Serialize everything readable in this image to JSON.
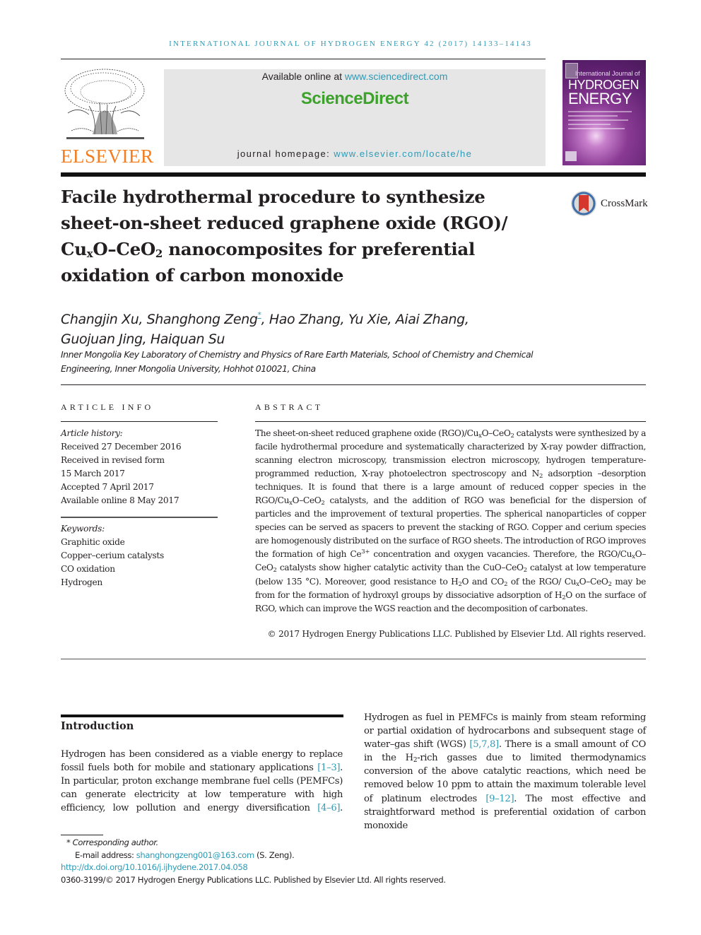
{
  "running_header": "INTERNATIONAL JOURNAL OF HYDROGEN ENERGY 42 (2017) 14133–14143",
  "publisher": {
    "logo_text": "ELSEVIER",
    "brand_color": "#f47d20"
  },
  "sciencedirect": {
    "available_prefix": "Available online at ",
    "available_link": "www.sciencedirect.com",
    "brand": "ScienceDirect",
    "brand_color": "#3da22b",
    "homepage_prefix": "journal homepage: ",
    "homepage_link": "www.elsevier.com/locate/he"
  },
  "cover": {
    "line1": "International Journal of",
    "line2": "HYDROGEN",
    "line3": "ENERGY"
  },
  "crossmark": {
    "label": "CrossMark"
  },
  "article": {
    "title_line1": "Facile hydrothermal procedure to synthesize",
    "title_line2": "sheet-on-sheet reduced graphene oxide (RGO)/",
    "title_line3_parts": [
      "Cu",
      "x",
      "O–CeO",
      "2",
      " nanocomposites for preferential"
    ],
    "title_line4": "oxidation of carbon monoxide",
    "authors_line1_a": "Changjin Xu, Shanghong Zeng",
    "authors_star": "*",
    "authors_line1_b": ", Hao Zhang, Yu Xie, Aiai Zhang,",
    "authors_line2": "Guojuan Jing, Haiquan Su",
    "affiliation_line1": "Inner Mongolia Key Laboratory of Chemistry and Physics of Rare Earth Materials, School of Chemistry and Chemical",
    "affiliation_line2": "Engineering, Inner Mongolia University, Hohhot 010021, China"
  },
  "article_info": {
    "label": "ARTICLE INFO",
    "history_heading": "Article history:",
    "history": [
      "Received 27 December 2016",
      "Received in revised form",
      "15 March 2017",
      "Accepted 7 April 2017",
      "Available online 8 May 2017"
    ],
    "keywords_heading": "Keywords:",
    "keywords": [
      "Graphitic oxide",
      "Copper–cerium catalysts",
      "CO oxidation",
      "Hydrogen"
    ]
  },
  "abstract": {
    "label": "ABSTRACT",
    "s1a": "The sheet-on-sheet reduced graphene oxide (RGO)/Cu",
    "s1b": "O–CeO",
    "s1c": " catalysts were synthesized by a facile hydrothermal procedure and systematically characterized by X-ray powder diffraction, scanning electron microscopy, transmission electron microscopy, hydrogen temperature-programmed reduction, X-ray photoelectron spectroscopy and N",
    "s1d": " adsorption –desorption techniques. It is found that there is a large amount of reduced copper species in the RGO/Cu",
    "s1e": "O–CeO",
    "s1f": " catalysts, and the addition of RGO was beneficial for the dispersion of particles and the improvement of textural properties. The spherical nanoparticles of copper species can be served as spacers to prevent the stacking of RGO. Copper and cerium species are homogenously distributed on the surface of RGO sheets. The introduction of RGO improves the formation of high Ce",
    "s1g": " concentration and oxygen vacancies. Therefore, the RGO/Cu",
    "s1h": "O–CeO",
    "s1i": " catalysts show higher catalytic activity than the CuO–CeO",
    "s1j": " catalyst at low temperature (below 135 °C). Moreover, good resistance to H",
    "s1k": "O and CO",
    "s1l": " of the RGO/ Cu",
    "s1m": "O–CeO",
    "s1n": " may be from for the formation of hydroxyl groups by dissociative adsorption of H",
    "s1o": "O on the surface of RGO, which can improve the WGS reaction and the decomposition of carbonates.",
    "sub_x": "x",
    "sub_2": "2",
    "sup_3plus": "3+",
    "copyright": "© 2017 Hydrogen Energy Publications LLC. Published by Elsevier Ltd. All rights reserved."
  },
  "introduction": {
    "heading": "Introduction",
    "p1a": "Hydrogen has been considered as a viable energy to replace fossil fuels both for mobile and stationary applications ",
    "ref1": "[1–3]",
    "p1b": ". In particular, proton exchange membrane fuel cells (PEMFCs) can generate electricity at low temperature with high efficiency, low pollution and energy diversification ",
    "ref2": "[4–6]",
    "p1c": ".",
    "p2a": "Hydrogen as fuel in PEMFCs is mainly from steam reforming or partial oxidation of hydrocarbons and subsequent stage of water–gas shift (WGS) ",
    "ref3": "[5,7,8]",
    "p2b": ". There is a small amount of CO in the H",
    "p2sub": "2",
    "p2c": "-rich gasses due to limited thermodynamics conversion of the above catalytic reactions, which need be removed below 10 ppm to attain the maximum tolerable level of platinum electrodes ",
    "ref4": "[9–12]",
    "p2d": ". The most effective and straightforward method is preferential oxidation of carbon monoxide"
  },
  "footnotes": {
    "corresponding": "* Corresponding author.",
    "email_label": "E-mail address: ",
    "email": "shanghongzeng001@163.com",
    "email_suffix": " (S. Zeng).",
    "doi": "http://dx.doi.org/10.1016/j.ijhydene.2017.04.058",
    "issn_copyright": "0360-3199/© 2017 Hydrogen Energy Publications LLC. Published by Elsevier Ltd. All rights reserved."
  },
  "colors": {
    "link": "#2e9ab5",
    "text": "#231f20",
    "header_box": "#e6e6e6"
  }
}
